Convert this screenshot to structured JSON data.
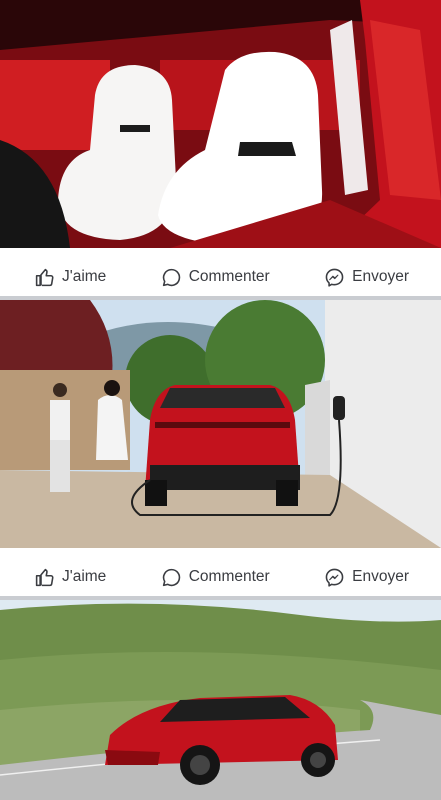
{
  "posts": [
    {
      "image_desc_icon": "photo",
      "actions": {
        "like": "J'aime",
        "comment": "Commenter",
        "share": "Envoyer"
      }
    },
    {
      "image_desc_icon": "photo",
      "actions": {
        "like": "J'aime",
        "comment": "Commenter",
        "share": "Envoyer"
      }
    },
    {
      "image_desc_icon": "photo"
    }
  ],
  "colors": {
    "brand_red": "#c3121d",
    "action_text": "#3b3d42",
    "separator": "#c9ccd1"
  }
}
